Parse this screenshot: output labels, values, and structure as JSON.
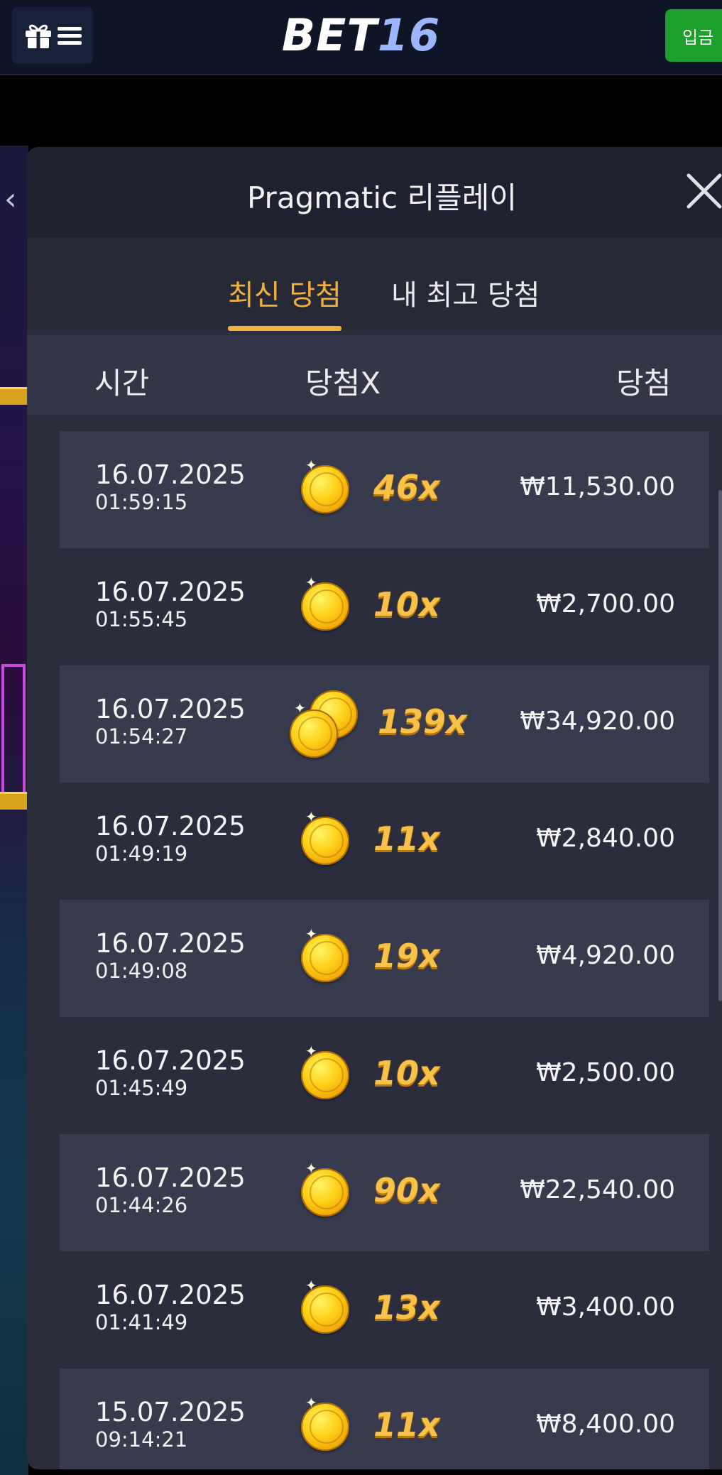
{
  "header": {
    "logo_main": "BET",
    "logo_num": "16",
    "deposit_label": "입금"
  },
  "panel": {
    "title": "Pragmatic 리플레이",
    "tabs": [
      {
        "label": "최신 당첨",
        "active": true
      },
      {
        "label": "내 최고 당첨",
        "active": false
      }
    ],
    "columns": {
      "time": "시간",
      "multiplier": "당첨X",
      "win": "당첨"
    }
  },
  "rows": [
    {
      "date": "16.07.2025",
      "time": "01:59:15",
      "multiplier": "46x",
      "amount": "₩11,530.00",
      "coins": 1
    },
    {
      "date": "16.07.2025",
      "time": "01:55:45",
      "multiplier": "10x",
      "amount": "₩2,700.00",
      "coins": 1
    },
    {
      "date": "16.07.2025",
      "time": "01:54:27",
      "multiplier": "139x",
      "amount": "₩34,920.00",
      "coins": 2
    },
    {
      "date": "16.07.2025",
      "time": "01:49:19",
      "multiplier": "11x",
      "amount": "₩2,840.00",
      "coins": 1
    },
    {
      "date": "16.07.2025",
      "time": "01:49:08",
      "multiplier": "19x",
      "amount": "₩4,920.00",
      "coins": 1
    },
    {
      "date": "16.07.2025",
      "time": "01:45:49",
      "multiplier": "10x",
      "amount": "₩2,500.00",
      "coins": 1
    },
    {
      "date": "16.07.2025",
      "time": "01:44:26",
      "multiplier": "90x",
      "amount": "₩22,540.00",
      "coins": 1
    },
    {
      "date": "16.07.2025",
      "time": "01:41:49",
      "multiplier": "13x",
      "amount": "₩3,400.00",
      "coins": 1
    },
    {
      "date": "15.07.2025",
      "time": "09:14:21",
      "multiplier": "11x",
      "amount": "₩8,400.00",
      "coins": 1
    }
  ],
  "colors": {
    "accent": "#f2b13d",
    "deposit": "#1d9f2b",
    "panel": "#2b2d3d"
  },
  "icons": {
    "menu": "gift-menu-icon",
    "close": "close-icon",
    "back": "chevron-left-icon",
    "coin": "gold-coin-icon"
  }
}
